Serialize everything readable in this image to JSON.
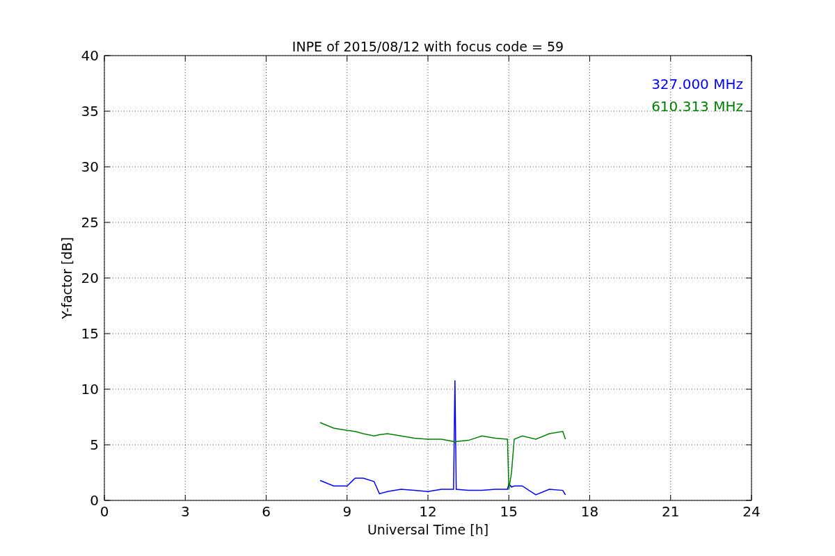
{
  "chart_data": {
    "type": "line",
    "title": "INPE of 2015/08/12 with focus code = 59",
    "xlabel": "Universal Time [h]",
    "ylabel": "Y-factor [dB]",
    "x": [
      8,
      8.5,
      9,
      9.3,
      9.6,
      10,
      10.2,
      10.5,
      11,
      11.5,
      12,
      12.5,
      12.95,
      13,
      13.05,
      13.5,
      14,
      14.5,
      14.95,
      15,
      15.1,
      15.2,
      15.5,
      16,
      16.5,
      17,
      17.1
    ],
    "series": [
      {
        "name": "327.000 MHz",
        "color": "#0000ff",
        "values": [
          1.8,
          1.3,
          1.3,
          2.0,
          2.0,
          1.7,
          0.6,
          0.8,
          1.0,
          0.9,
          0.8,
          1.0,
          1.0,
          10.8,
          1.0,
          0.9,
          0.9,
          1.0,
          1.0,
          1.5,
          1.2,
          1.3,
          1.3,
          0.5,
          1.0,
          0.9,
          0.5
        ]
      },
      {
        "name": "610.313 MHz",
        "color": "#008000",
        "values": [
          7.0,
          6.5,
          6.3,
          6.2,
          6.0,
          5.8,
          5.9,
          6.0,
          5.8,
          5.6,
          5.5,
          5.5,
          5.3,
          5.2,
          5.3,
          5.4,
          5.8,
          5.6,
          5.5,
          1.0,
          2.5,
          5.5,
          5.8,
          5.5,
          6.0,
          6.2,
          5.5
        ]
      }
    ],
    "xlim": [
      0,
      24
    ],
    "ylim": [
      0,
      40
    ],
    "xticks": [
      0,
      3,
      6,
      9,
      12,
      15,
      18,
      21,
      24
    ],
    "yticks": [
      0,
      5,
      10,
      15,
      20,
      25,
      30,
      35,
      40
    ],
    "grid": true
  }
}
